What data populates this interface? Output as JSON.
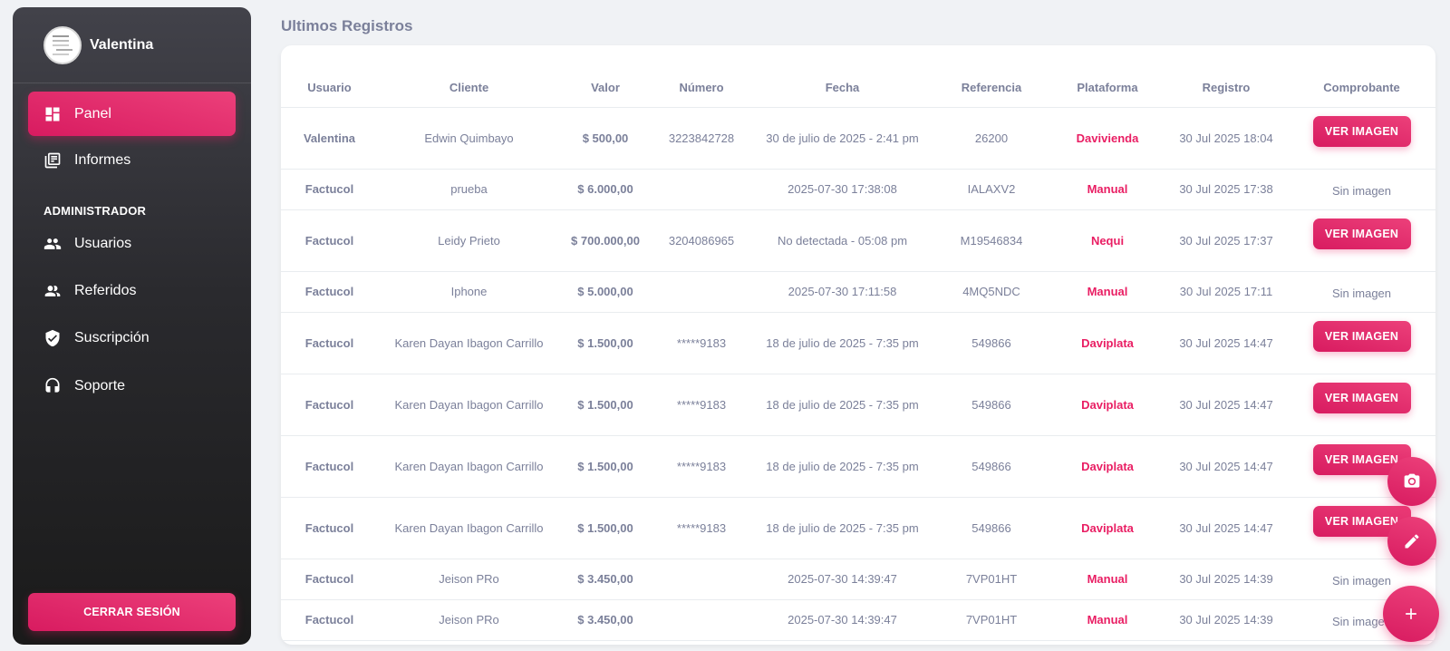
{
  "sidebar": {
    "user_name": "Valentina",
    "items": [
      {
        "label": "Panel",
        "icon": "dashboard-icon"
      },
      {
        "label": "Informes",
        "icon": "reports-icon"
      }
    ],
    "section_label": "ADMINISTRADOR",
    "admin_items": [
      {
        "label": "Usuarios",
        "icon": "users-icon"
      },
      {
        "label": "Referidos",
        "icon": "referrals-icon"
      },
      {
        "label": "Suscripción",
        "icon": "verified-shield-icon"
      },
      {
        "label": "Soporte",
        "icon": "support-headset-icon"
      }
    ],
    "logout_label": "CERRAR SESIÓN"
  },
  "main": {
    "title": "Ultimos Registros",
    "columns": [
      "Usuario",
      "Cliente",
      "Valor",
      "Número",
      "Fecha",
      "Referencia",
      "Plataforma",
      "Registro",
      "Comprobante"
    ],
    "view_label": "VER IMAGEN",
    "no_image_label": "Sin imagen",
    "rows": [
      {
        "usuario": "Valentina",
        "cliente": "Edwin Quimbayo",
        "valor": "$ 500,00",
        "numero": "3223842728",
        "fecha": "30 de julio de 2025 - 2:41 pm",
        "referencia": "26200",
        "plataforma": "Davivienda",
        "registro": "30 Jul 2025 18:04",
        "comprobante": "VER IMAGEN"
      },
      {
        "usuario": "Factucol",
        "cliente": "prueba",
        "valor": "$ 6.000,00",
        "numero": "",
        "fecha": "2025-07-30 17:38:08",
        "referencia": "IALAXV2",
        "plataforma": "Manual",
        "registro": "30 Jul 2025 17:38",
        "comprobante": "Sin imagen"
      },
      {
        "usuario": "Factucol",
        "cliente": "Leidy Prieto",
        "valor": "$ 700.000,00",
        "numero": "3204086965",
        "fecha": "No detectada - 05:08 pm",
        "referencia": "M19546834",
        "plataforma": "Nequi",
        "registro": "30 Jul 2025 17:37",
        "comprobante": "VER IMAGEN"
      },
      {
        "usuario": "Factucol",
        "cliente": "Iphone",
        "valor": "$ 5.000,00",
        "numero": "",
        "fecha": "2025-07-30 17:11:58",
        "referencia": "4MQ5NDC",
        "plataforma": "Manual",
        "registro": "30 Jul 2025 17:11",
        "comprobante": "Sin imagen"
      },
      {
        "usuario": "Factucol",
        "cliente": "Karen Dayan Ibagon Carrillo",
        "valor": "$ 1.500,00",
        "numero": "*****9183",
        "fecha": "18 de julio de 2025 - 7:35 pm",
        "referencia": "549866",
        "plataforma": "Daviplata",
        "registro": "30 Jul 2025 14:47",
        "comprobante": "VER IMAGEN"
      },
      {
        "usuario": "Factucol",
        "cliente": "Karen Dayan Ibagon Carrillo",
        "valor": "$ 1.500,00",
        "numero": "*****9183",
        "fecha": "18 de julio de 2025 - 7:35 pm",
        "referencia": "549866",
        "plataforma": "Daviplata",
        "registro": "30 Jul 2025 14:47",
        "comprobante": "VER IMAGEN"
      },
      {
        "usuario": "Factucol",
        "cliente": "Karen Dayan Ibagon Carrillo",
        "valor": "$ 1.500,00",
        "numero": "*****9183",
        "fecha": "18 de julio de 2025 - 7:35 pm",
        "referencia": "549866",
        "plataforma": "Daviplata",
        "registro": "30 Jul 2025 14:47",
        "comprobante": "VER IMAGEN"
      },
      {
        "usuario": "Factucol",
        "cliente": "Karen Dayan Ibagon Carrillo",
        "valor": "$ 1.500,00",
        "numero": "*****9183",
        "fecha": "18 de julio de 2025 - 7:35 pm",
        "referencia": "549866",
        "plataforma": "Daviplata",
        "registro": "30 Jul 2025 14:47",
        "comprobante": "VER IMAGEN"
      },
      {
        "usuario": "Factucol",
        "cliente": "Jeison PRo",
        "valor": "$ 3.450,00",
        "numero": "",
        "fecha": "2025-07-30 14:39:47",
        "referencia": "7VP01HT",
        "plataforma": "Manual",
        "registro": "30 Jul 2025 14:39",
        "comprobante": "Sin imagen"
      },
      {
        "usuario": "Factucol",
        "cliente": "Jeison PRo",
        "valor": "$ 3.450,00",
        "numero": "",
        "fecha": "2025-07-30 14:39:47",
        "referencia": "7VP01HT",
        "plataforma": "Manual",
        "registro": "30 Jul 2025 14:39",
        "comprobante": "Sin imagen"
      }
    ]
  },
  "fabs": [
    {
      "icon": "camera-icon"
    },
    {
      "icon": "edit-pencil-icon"
    },
    {
      "icon": "plus-icon"
    }
  ],
  "colors": {
    "accent": "#e91e63",
    "sidebar_top": "#42424a",
    "sidebar_bottom": "#1a1a1a",
    "background": "#f0f2f5"
  }
}
